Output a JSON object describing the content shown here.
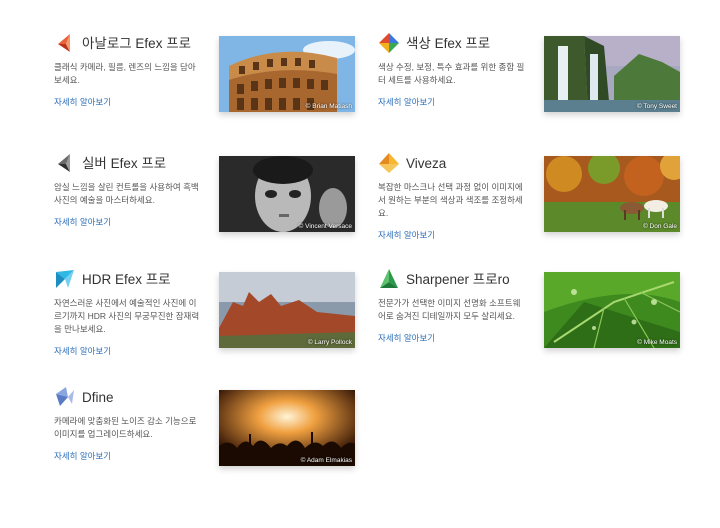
{
  "more_label": "자세히 알아보기",
  "products": {
    "analog": {
      "title": "아날로그 Efex 프로",
      "desc": "클래식 카메라, 필름, 렌즈의 느낌을 담아보세요.",
      "credit": "© Brian Matiash"
    },
    "color": {
      "title": "색상 Efex 프로",
      "desc": "색상 수정, 보정, 특수 효과를 위한 종합 필터 세트를 사용하세요.",
      "credit": "© Tony Sweet"
    },
    "silver": {
      "title": "실버 Efex 프로",
      "desc": "암실 느낌을 살린 컨트롤을 사용하여 흑백 사진의 예술을 마스터하세요.",
      "credit": "© Vincent Versace"
    },
    "viveza": {
      "title": "Viveza",
      "desc": "복잡한 마스크나 선택 과정 없이 이미지에서 원하는 부분의 색상과 색조를 조정하세요.",
      "credit": "© Don Gale"
    },
    "hdr": {
      "title": "HDR Efex 프로",
      "desc": "자연스러운 사진에서 예술적인 사진에 이르기까지 HDR 사진의 무궁무진한 잠재력을 만나보세요.",
      "credit": "© Larry Pollock"
    },
    "sharp": {
      "title": "Sharpener 프로ro",
      "desc": "전문가가 선택한 이미지 선명화 소프트웨어로 숨겨진 디테일까지 모두 살리세요.",
      "credit": "© Mike Moats"
    },
    "dfine": {
      "title": "Dfine",
      "desc": "카메라에 맞춤화된 노이즈 감소 기능으로 이미지를 업그레이드하세요.",
      "credit": "© Adam Elmakias"
    }
  },
  "colors": {
    "link": "#2d6fb8",
    "analog_logo": "#d9472b",
    "color_logo": "#3f6fd8",
    "silver_logo": "#4a4a4a",
    "viveza_logo": "#f0a020",
    "hdr_logo": "#1fa8d8",
    "sharp_logo": "#2c9a4a",
    "dfine_logo": "#6f8fd0"
  }
}
